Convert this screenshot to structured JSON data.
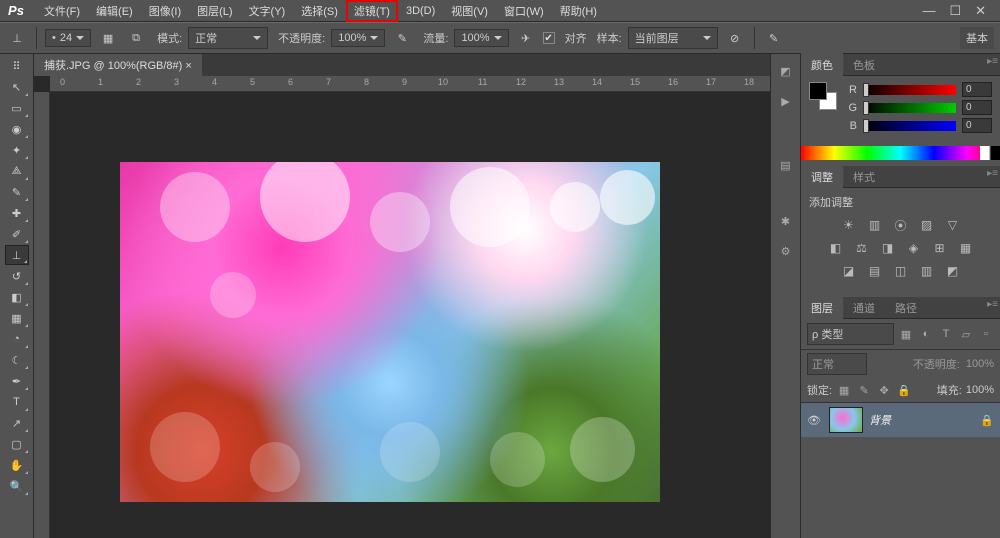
{
  "menu": {
    "items": [
      "文件(F)",
      "编辑(E)",
      "图像(I)",
      "图层(L)",
      "文字(Y)",
      "选择(S)",
      "滤镜(T)",
      "3D(D)",
      "视图(V)",
      "窗口(W)",
      "帮助(H)"
    ],
    "highlight": 6
  },
  "options": {
    "brush_size": "24",
    "mode_label": "模式:",
    "mode_value": "正常",
    "opacity_label": "不透明度:",
    "opacity_value": "100%",
    "flow_label": "流量:",
    "flow_value": "100%",
    "align_label": "对齐",
    "sample_label": "样本:",
    "sample_value": "当前图层",
    "extra": "基本"
  },
  "file_tab": "捕获.JPG @ 100%(RGB/8#) ×",
  "ruler": [
    "0",
    "1",
    "2",
    "3",
    "4",
    "5",
    "6",
    "7",
    "8",
    "9",
    "10",
    "11",
    "12",
    "13",
    "14",
    "15",
    "16",
    "17",
    "18"
  ],
  "panels": {
    "color_tab": "颜色",
    "swatches_tab": "色板",
    "rgb": [
      {
        "l": "R",
        "v": "0"
      },
      {
        "l": "G",
        "v": "0"
      },
      {
        "l": "B",
        "v": "0"
      }
    ],
    "adjust_tab": "调整",
    "styles_tab": "样式",
    "adjust_title": "添加调整",
    "layers_tab": "图层",
    "channels_tab": "通道",
    "paths_tab": "路径",
    "kind_label": "ρ 类型",
    "blend": "正常",
    "opacity_l": "不透明度:",
    "opacity_v": "100%",
    "lock_l": "锁定:",
    "fill_l": "填充:",
    "fill_v": "100%",
    "layer_name": "背景"
  }
}
